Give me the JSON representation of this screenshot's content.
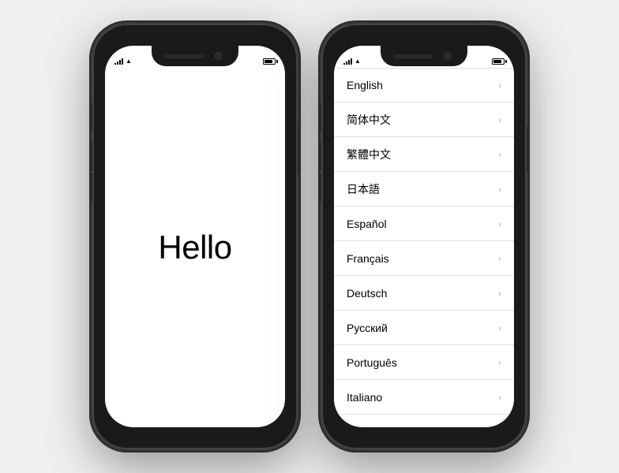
{
  "phones": [
    {
      "id": "hello-phone",
      "statusBar": {
        "signal": [
          2,
          4,
          6,
          8,
          10
        ],
        "batteryLevel": 80
      },
      "content": {
        "type": "hello",
        "greeting": "Hello"
      }
    },
    {
      "id": "language-phone",
      "statusBar": {
        "signal": [
          2,
          4,
          6,
          8,
          10
        ],
        "batteryLevel": 80
      },
      "content": {
        "type": "language-list",
        "languages": [
          "English",
          "简体中文",
          "繁體中文",
          "日本語",
          "Español",
          "Français",
          "Deutsch",
          "Русский",
          "Português",
          "Italiano"
        ]
      }
    }
  ]
}
